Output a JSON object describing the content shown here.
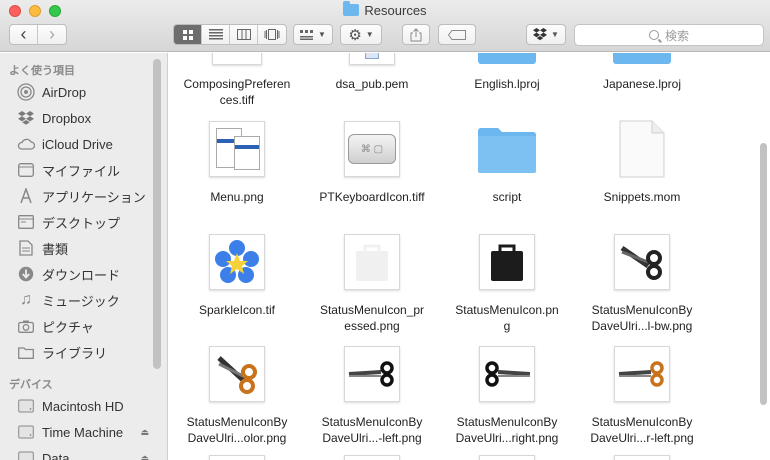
{
  "window": {
    "title": "Resources"
  },
  "toolbar": {
    "back": "‹",
    "forward": "›",
    "search_placeholder": "検索"
  },
  "sidebar": {
    "favorites_header": "よく使う項目",
    "favorites": [
      {
        "label": "AirDrop",
        "icon": "airdrop-icon"
      },
      {
        "label": "Dropbox",
        "icon": "dropbox-icon"
      },
      {
        "label": "iCloud Drive",
        "icon": "cloud-icon"
      },
      {
        "label": "マイファイル",
        "icon": "myfiles-icon"
      },
      {
        "label": "アプリケーション",
        "icon": "applications-icon"
      },
      {
        "label": "デスクトップ",
        "icon": "desktop-icon"
      },
      {
        "label": "書類",
        "icon": "documents-icon"
      },
      {
        "label": "ダウンロード",
        "icon": "download-icon"
      },
      {
        "label": "ミュージック",
        "icon": "music-icon"
      },
      {
        "label": "ピクチャ",
        "icon": "camera-icon"
      },
      {
        "label": "ライブラリ",
        "icon": "folder-icon"
      }
    ],
    "devices_header": "デバイス",
    "devices": [
      {
        "label": "Macintosh HD",
        "icon": "disk-icon"
      },
      {
        "label": "Time Machine",
        "icon": "disk-icon"
      },
      {
        "label": "Data",
        "icon": "disk-icon"
      }
    ]
  },
  "files": [
    {
      "name": "ComposingPreferen\nces.tiff"
    },
    {
      "name": "dsa_pub.pem"
    },
    {
      "name": "English.lproj"
    },
    {
      "name": "Japanese.lproj"
    },
    {
      "name": "Menu.png"
    },
    {
      "name": "PTKeyboardIcon.tiff"
    },
    {
      "name": "script"
    },
    {
      "name": "Snippets.mom"
    },
    {
      "name": "SparkleIcon.tif"
    },
    {
      "name": "StatusMenuIcon_pr\nessed.png"
    },
    {
      "name": "StatusMenuIcon.pn\ng"
    },
    {
      "name": "StatusMenuIconBy\nDaveUlri...l-bw.png"
    },
    {
      "name": "StatusMenuIconBy\nDaveUlri...olor.png"
    },
    {
      "name": "StatusMenuIconBy\nDaveUlri...-left.png"
    },
    {
      "name": "StatusMenuIconBy\nDaveUlri...right.png"
    },
    {
      "name": "StatusMenuIconBy\nDaveUlri...r-left.png"
    }
  ],
  "colors": {
    "folder": "#6db7ef",
    "sidebar_bg": "#ececec",
    "accent_scissor": "#c8721c"
  }
}
